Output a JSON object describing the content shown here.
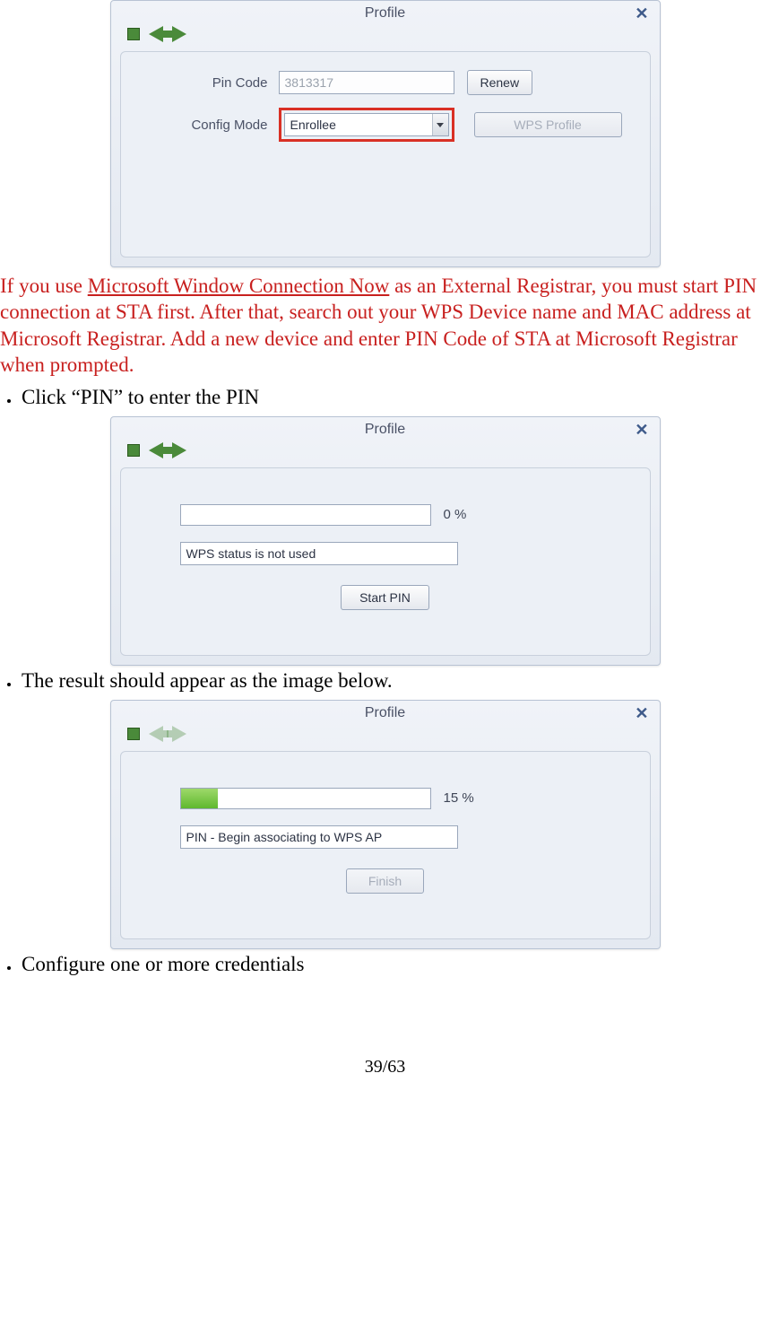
{
  "dialog1": {
    "title": "Profile",
    "pinLabel": "Pin Code",
    "pinValue": "3813317",
    "renewLabel": "Renew",
    "configLabel": "Config Mode",
    "configValue": "Enrollee",
    "wpsProfileLabel": "WPS Profile"
  },
  "note": {
    "prefix": "If you use ",
    "link": "Microsoft Window Connection Now",
    "rest": " as an External Registrar, you must start PIN connection at STA first. After that, search out your WPS Device name and MAC address at Microsoft Registrar. Add a new device and enter PIN Code of STA at Microsoft Registrar when prompted."
  },
  "bullets": {
    "b1": "Click “PIN” to enter the PIN",
    "b2": "The result should appear as the image below.",
    "b3": "Configure one or more credentials"
  },
  "dialog2": {
    "title": "Profile",
    "percent": "0 %",
    "status": "WPS status is not used",
    "startPinLabel": "Start PIN"
  },
  "dialog3": {
    "title": "Profile",
    "percent": "15 %",
    "progressFill": 15,
    "status": "PIN - Begin associating to WPS AP",
    "finishLabel": "Finish"
  },
  "pageNumber": "39/63"
}
